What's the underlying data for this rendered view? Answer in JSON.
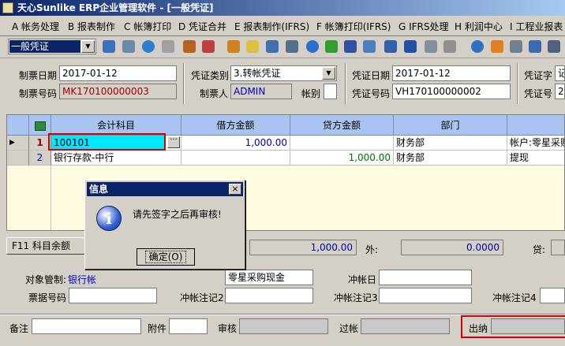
{
  "window": {
    "title": "天心Sunlike ERP企业管理软件 - [一般凭证]"
  },
  "menu": [
    "A 帐务处理",
    "B 报表制作",
    "C 帐簿打印",
    "D 凭证合并",
    "E 报表制作(IFRS)",
    "F 帐簿打印(IFRS)",
    "G IFRS处理",
    "H 利润中心",
    "I 工程业报表"
  ],
  "toolbar": {
    "voucher_type": "一般凭证"
  },
  "header": {
    "make_date_label": "制票日期",
    "make_date": "2017-01-12",
    "make_no_label": "制票号码",
    "make_no": "MK170100000003",
    "voucher_cat_label": "凭证类别",
    "voucher_cat": "3.转帐凭证",
    "maker_label": "制票人",
    "maker": "ADMIN",
    "currency_label": "帐别",
    "currency": "",
    "voucher_date_label": "凭证日期",
    "voucher_date": "2017-01-12",
    "voucher_no_label": "凭证号码",
    "voucher_no": "VH170100000002",
    "voucher_word_label": "凭证字",
    "voucher_word": "记",
    "voucher_num_label": "凭证号",
    "voucher_num": "2"
  },
  "grid": {
    "columns": [
      "会计科目",
      "借方金额",
      "贷方金额",
      "部门"
    ],
    "rows": [
      {
        "no": "1",
        "account": "100101",
        "debit": "1,000.00",
        "credit": "",
        "dept": "财务部",
        "extra": "帐户:零星采购"
      },
      {
        "no": "2",
        "account": "银行存款-中行",
        "debit": "",
        "credit": "1,000.00",
        "dept": "财务部",
        "extra": "提现"
      }
    ]
  },
  "summary": {
    "f11_label": "F11 科目余额",
    "amount": "1,000.00",
    "foreign_label": "外:",
    "foreign": "0.0000",
    "credit_label": "贷:"
  },
  "detail": {
    "object_label": "对象管制:",
    "object_value": "银行帐",
    "summary_value": "零星采购现金",
    "offset_date_label": "冲帐日",
    "bill_no_label": "票据号码",
    "note2_label": "冲帐注记2",
    "note3_label": "冲帐注记3",
    "note4_label": "冲帐注记4"
  },
  "footer": {
    "remark_label": "备注",
    "attach_label": "附件",
    "audit_label": "审核",
    "post_label": "过帐",
    "cashier_label": "出纳"
  },
  "dialog": {
    "title": "信息",
    "close": "×",
    "message": "请先签字之后再审核!",
    "ok": "确定(O)"
  }
}
